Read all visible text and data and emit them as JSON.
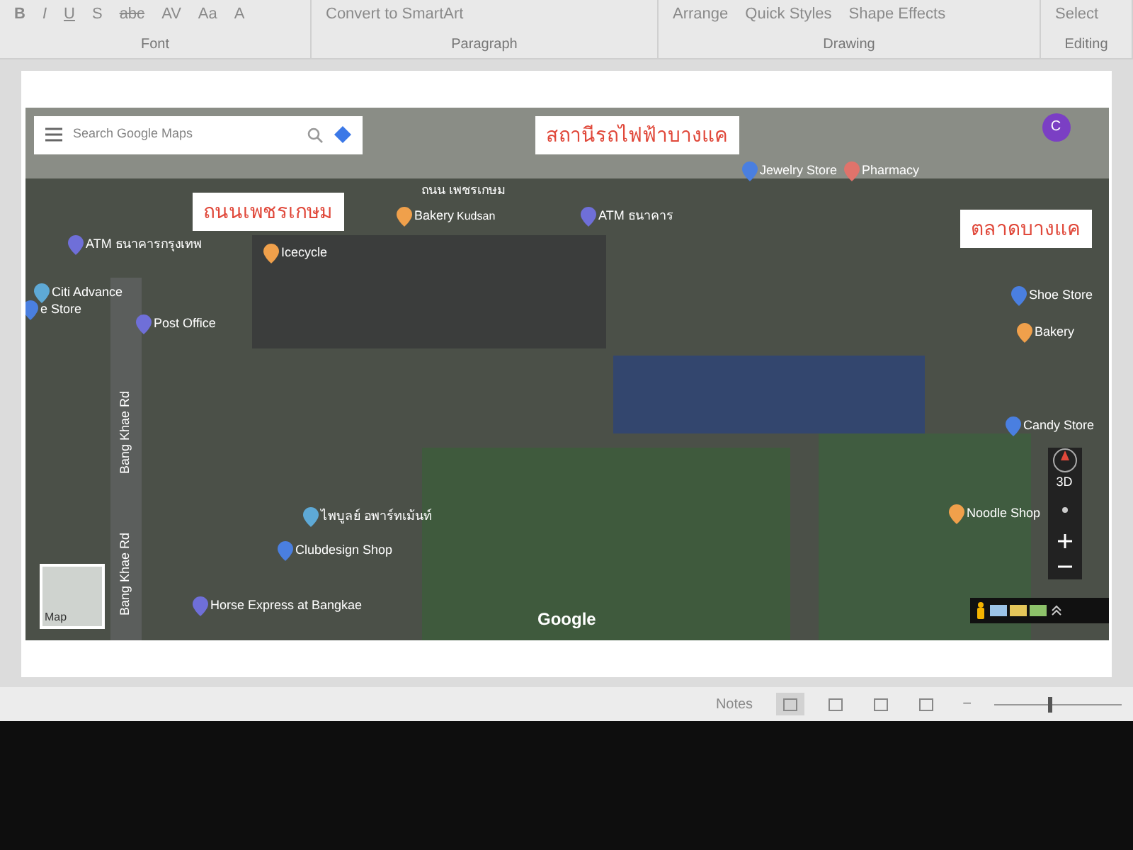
{
  "ribbon": {
    "groups": [
      {
        "label": "Font",
        "buttons": [
          "B",
          "I",
          "U",
          "S",
          "abc",
          "AV",
          "Aa",
          "A"
        ]
      },
      {
        "label": "Paragraph",
        "buttons": [
          "Convert to SmartArt"
        ]
      },
      {
        "label": "Drawing",
        "buttons": [
          "Arrange",
          "Quick Styles",
          "Shape Effects"
        ]
      },
      {
        "label": "Editing",
        "buttons": [
          "Select"
        ]
      }
    ]
  },
  "map": {
    "search": {
      "placeholder": "Search Google Maps"
    },
    "avatar": "C",
    "callouts": [
      {
        "text": "สถานีรถไฟฟ้าบางแค"
      },
      {
        "text": "ถนนเพชรเกษม"
      },
      {
        "text": "ตลาดบางแค"
      }
    ],
    "roads": [
      {
        "text": "ถนน เพชรเกษม",
        "kind": "horizontal"
      },
      {
        "text": "Bang Khae Rd",
        "kind": "vertical"
      },
      {
        "text": "Bang Khae Rd",
        "kind": "vertical"
      }
    ],
    "places": [
      {
        "name": "ATM ธนาคารกรุงเทพ",
        "color": "#6f6fd8"
      },
      {
        "name": "Icecycle",
        "color": "#f0a04b"
      },
      {
        "name": "Bakery",
        "sub": "Kudsan",
        "color": "#f0a04b"
      },
      {
        "name": "Citi Advance",
        "color": "#5ea9d6"
      },
      {
        "name": "e Store",
        "color": "#4a7fe0"
      },
      {
        "name": "Post Office",
        "color": "#6f6fd8"
      },
      {
        "name": "ATM ธนาคาร",
        "color": "#6f6fd8"
      },
      {
        "name": "Jewelry Store",
        "color": "#4a7fe0"
      },
      {
        "name": "Pharmacy",
        "color": "#e0736b"
      },
      {
        "name": "Shoe Store",
        "color": "#4a7fe0"
      },
      {
        "name": "Bakery",
        "color": "#f0a04b"
      },
      {
        "name": "Candy Store",
        "color": "#4a7fe0"
      },
      {
        "name": "Noodle Shop",
        "color": "#f0a04b"
      },
      {
        "name": "ไพบูลย์ อพาร์ทเม้นท์",
        "color": "#5ea9d6"
      },
      {
        "name": "Clubdesign Shop",
        "color": "#4a7fe0"
      },
      {
        "name": "Horse Express at Bangkae",
        "color": "#6f6fd8"
      }
    ],
    "logo": "Google",
    "layer": "Map",
    "view_3d": "3D"
  },
  "status_bar": {
    "notes": "Notes",
    "views": [
      {
        "selected": true
      },
      {
        "selected": false
      },
      {
        "selected": false
      },
      {
        "selected": false
      }
    ],
    "zoom_out": "−",
    "zoom": {
      "level": 0.42
    }
  }
}
